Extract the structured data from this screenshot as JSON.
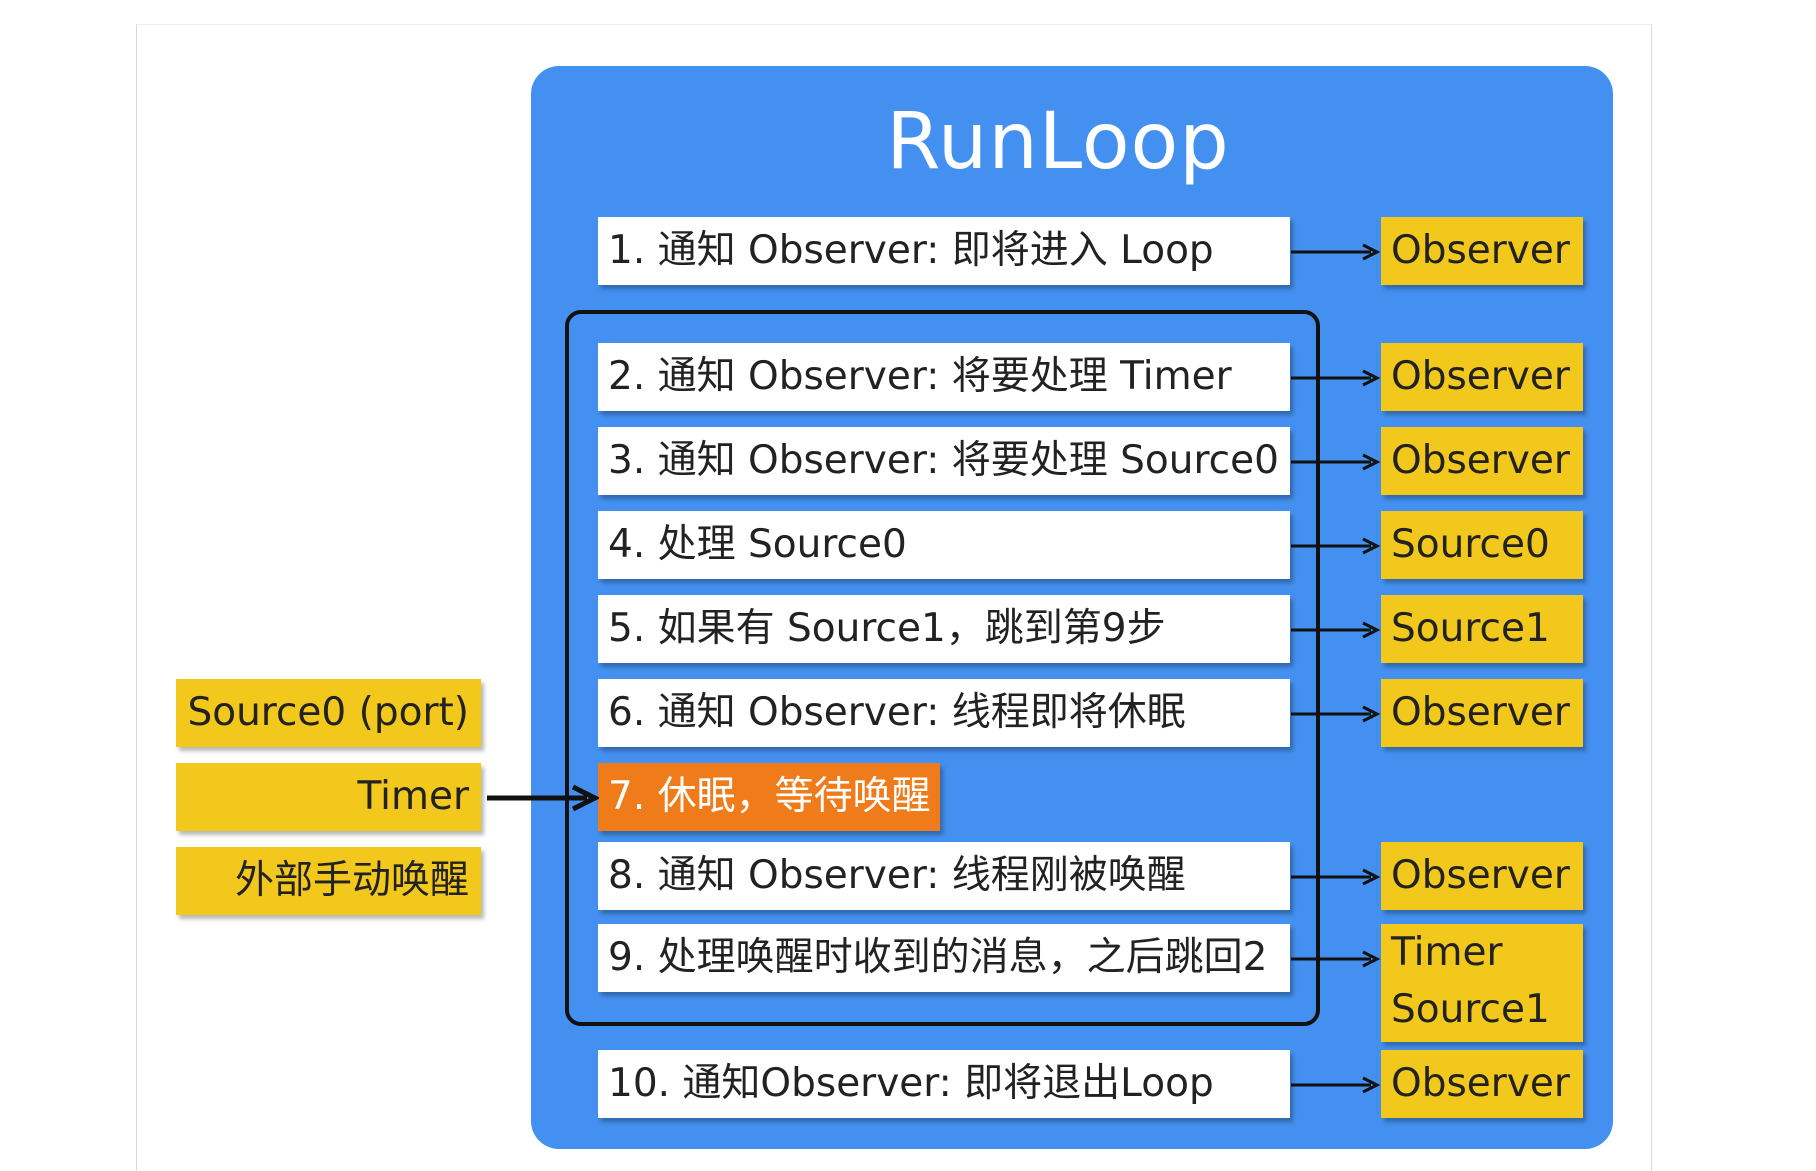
{
  "colors": {
    "panel": "#4490f0",
    "white_box": "#ffffff",
    "yellow": "#f2c81c",
    "highlight": "#ef7b1b",
    "loop_border": "#111111",
    "arrow": "#111111"
  },
  "diagram": {
    "title": "RunLoop",
    "steps": [
      {
        "label": "1. 通知 Observer: 即将进入 Loop"
      },
      {
        "label": "2. 通知 Observer: 将要处理 Timer"
      },
      {
        "label": "3. 通知 Observer: 将要处理 Source0"
      },
      {
        "label": "4. 处理 Source0"
      },
      {
        "label": "5. 如果有 Source1，跳到第9步"
      },
      {
        "label": "6. 通知 Observer: 线程即将休眠"
      },
      {
        "label": "7. 休眠，等待唤醒"
      },
      {
        "label": "8. 通知 Observer: 线程刚被唤醒"
      },
      {
        "label": "9. 处理唤醒时收到的消息，之后跳回2"
      },
      {
        "label": "10. 通知Observer: 即将退出Loop"
      }
    ],
    "targets": [
      {
        "label": "Observer"
      },
      {
        "label": "Observer"
      },
      {
        "label": "Observer"
      },
      {
        "label": "Source0"
      },
      {
        "label": "Source1"
      },
      {
        "label": "Observer"
      },
      {
        "label": "Observer"
      },
      {
        "line1": "Timer",
        "line2": "Source1"
      },
      {
        "label": "Observer"
      }
    ],
    "wake_sources": [
      {
        "label": "Source0 (port)"
      },
      {
        "label": "Timer"
      },
      {
        "label": "外部手动唤醒"
      }
    ]
  }
}
